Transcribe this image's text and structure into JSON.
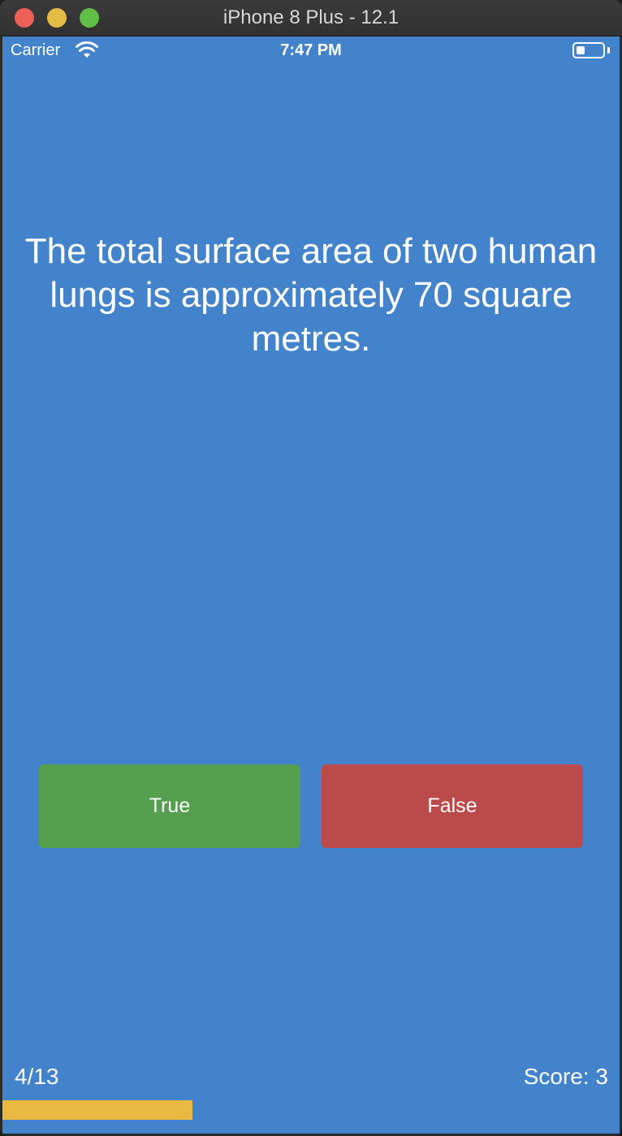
{
  "window": {
    "title": "iPhone 8 Plus - 12.1"
  },
  "status_bar": {
    "carrier": "Carrier",
    "time": "7:47 PM",
    "battery_level": 0.3
  },
  "quiz": {
    "question": "The total surface area of two human lungs is approximately 70 square metres.",
    "true_label": "True",
    "false_label": "False",
    "progress_text": "4/13",
    "score_text": "Score: 3",
    "progress_fraction": 0.3077
  },
  "colors": {
    "background": "#4283cc",
    "true_button": "#55a04e",
    "false_button": "#bb4a4a",
    "progress_bar": "#e9b941"
  }
}
